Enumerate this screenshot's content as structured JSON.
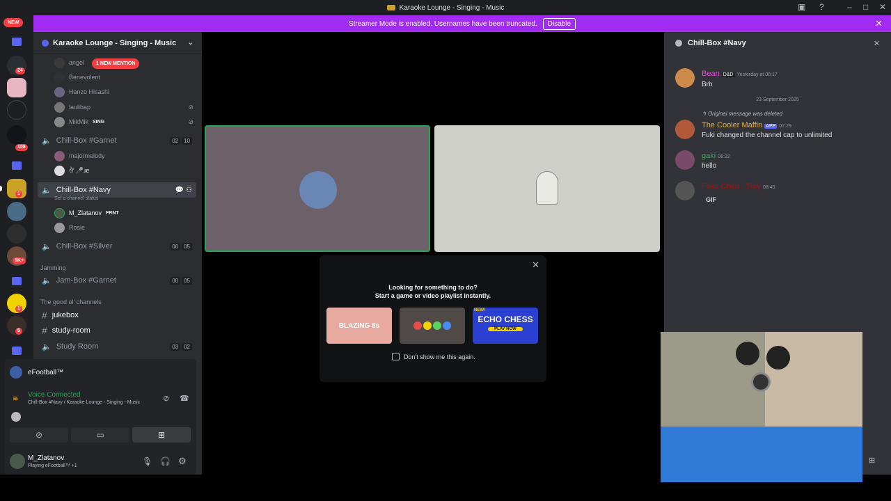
{
  "window": {
    "title": "Karaoke Lounge - Singing - Music"
  },
  "streamer_bar": {
    "text": "Streamer Mode is enabled. Usernames have been truncated.",
    "button": "Disable"
  },
  "guilds": {
    "new_label": "NEW",
    "badges": [
      "24",
      "108",
      "1",
      "5K+",
      "1",
      "5"
    ]
  },
  "server": {
    "name": "Karaoke Lounge - Singing - Music",
    "mention": "1 NEW MENTION"
  },
  "voice_users_top": [
    {
      "name": "angel"
    },
    {
      "name": "Benevolent"
    },
    {
      "name": "Hanzo Hisashi"
    },
    {
      "name": "laulibap"
    },
    {
      "name": "MikMik",
      "tag": "SING"
    }
  ],
  "channels": {
    "garnet": {
      "name": "Chill-Box #Garnet",
      "a": "02",
      "b": "10"
    },
    "navy": {
      "name": "Chill-Box #Navy",
      "status": "Set a channel status"
    },
    "silver": {
      "name": "Chill-Box #Silver",
      "a": "00",
      "b": "05"
    },
    "jam": {
      "name": "Jam-Box #Garnet",
      "a": "00",
      "b": "05"
    },
    "study_room": {
      "name": "Study Room",
      "a": "03",
      "b": "02"
    }
  },
  "garnet_users": [
    {
      "name": "majormelody"
    },
    {
      "name": "ঔ️ 🎤ɹɐ"
    }
  ],
  "navy_users": [
    {
      "name": "M_Zlatanov",
      "tag": "FRNT"
    },
    {
      "name": "Rosie"
    }
  ],
  "categories": {
    "jamming": "Jamming",
    "good": "The good ol' channels"
  },
  "text_channels": [
    "jukebox",
    "study-room"
  ],
  "activity": {
    "name": "eFootball™"
  },
  "voice": {
    "status": "Voice Connected",
    "sub": "Chill-Box #Navy / Karaoke Lounge - Singing - Music"
  },
  "user": {
    "name": "M_Zlatanov",
    "activity": "Playing eFootball™",
    "extra": "+1"
  },
  "picker": {
    "q1": "Looking for something to do?",
    "q2": "Start a game or video playlist instantly.",
    "dont_show": "Don't show me this again.",
    "games": [
      "BLAZING 8s",
      "Gems",
      "ECHO CHESS"
    ],
    "play_now": "PLAY NOW",
    "new": "NEW!"
  },
  "chat": {
    "title": "Chill-Box #Navy",
    "date_divider": "23 September 2025",
    "messages": [
      {
        "name": "Bean",
        "tag": "D&D",
        "time": "Yesterday at 06:17",
        "text": "Brb",
        "color": "#e34bd9"
      },
      {
        "reply": "Original message was deleted",
        "name": "The Cooler Maffin",
        "tag": "APP",
        "time": "07:29",
        "text": "Fuki changed the channel cap to unlimited",
        "color": "#f0b232"
      },
      {
        "name": "gaki",
        "time": "08:22",
        "text": "hello",
        "color": "#3ba55d"
      },
      {
        "name": "Fake Chen - Troy",
        "time": "08:40",
        "text": "GIF",
        "color": "#a41010"
      }
    ]
  }
}
